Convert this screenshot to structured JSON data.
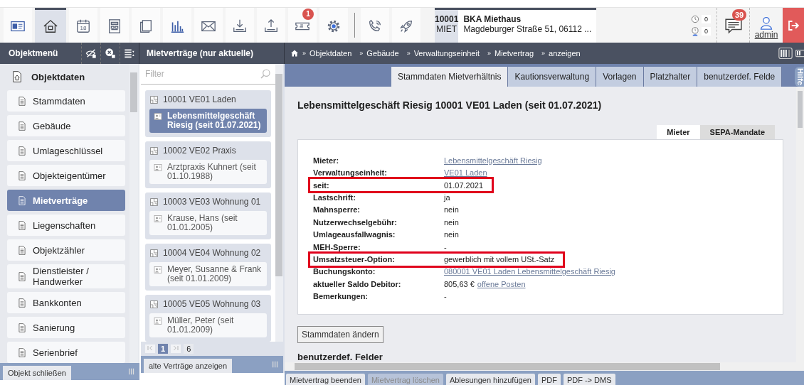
{
  "toolbar": {
    "icons": [
      {
        "kind": "contact-card",
        "selected": false
      },
      {
        "kind": "home",
        "selected": true
      },
      {
        "kind": "calendar",
        "selected": false,
        "label": "18"
      },
      {
        "kind": "form",
        "selected": false
      },
      {
        "kind": "documents",
        "selected": false
      },
      {
        "kind": "chart",
        "selected": false
      },
      {
        "kind": "mail",
        "selected": false
      },
      {
        "kind": "download",
        "selected": false
      },
      {
        "kind": "upload",
        "selected": false
      },
      {
        "kind": "ticket",
        "selected": false,
        "badge": "1"
      },
      {
        "kind": "gear",
        "selected": false
      },
      {
        "kind": "separator"
      },
      {
        "kind": "phone",
        "selected": false
      },
      {
        "kind": "rocket",
        "selected": false
      }
    ]
  },
  "object": {
    "number": "10001",
    "code": "MIET",
    "name": "BKA Miethaus",
    "address": "Magdeburger Straße 51, 06112 ..."
  },
  "counters": [
    {
      "kind": "clock",
      "value": "0"
    },
    {
      "kind": "person-clock",
      "value": "0"
    }
  ],
  "messages": {
    "badge": "39"
  },
  "user": {
    "name": "admin"
  },
  "object_menu": {
    "title": "Objektmenü",
    "header": "Objektdaten",
    "items": [
      {
        "label": "Stammdaten",
        "selected": false
      },
      {
        "label": "Gebäude",
        "selected": false
      },
      {
        "label": "Umlageschlüssel",
        "selected": false
      },
      {
        "label": "Objekteigentümer",
        "selected": false
      },
      {
        "label": "Mietverträge",
        "selected": true
      },
      {
        "label": "Liegenschaften",
        "selected": false
      },
      {
        "label": "Objektzähler",
        "selected": false
      },
      {
        "label": "Dienstleister / Handwerker",
        "selected": false
      },
      {
        "label": "Bankkonten",
        "selected": false
      },
      {
        "label": "Sanierung",
        "selected": false
      },
      {
        "label": "Serienbrief",
        "selected": false
      }
    ],
    "footer_button": "Objekt schließen"
  },
  "contracts": {
    "title": "Mietverträge (nur aktuelle)",
    "filter": {
      "placeholder": "Filter"
    },
    "units": [
      {
        "title": "10001 VE01 Laden",
        "contracts": [
          {
            "label": "Lebensmittelgeschäft Riesig (seit 01.07.2021)",
            "selected": true
          }
        ]
      },
      {
        "title": "10002 VE02 Praxis",
        "contracts": [
          {
            "label": "Arztpraxis Kuhnert (seit 01.10.1988)",
            "selected": false
          }
        ]
      },
      {
        "title": "10003 VE03 Wohnung 01",
        "contracts": [
          {
            "label": "Krause, Hans (seit 01.01.2005)",
            "selected": false
          }
        ]
      },
      {
        "title": "10004 VE04 Wohnung 02",
        "contracts": [
          {
            "label": "Meyer, Susanne & Frank (seit 01.01.2009)",
            "selected": false
          }
        ]
      },
      {
        "title": "10005 VE05 Wohnung 03",
        "contracts": [
          {
            "label": "Müller, Peter (seit 01.01.2009)",
            "selected": false
          }
        ]
      }
    ],
    "pager": {
      "current": "1",
      "total": "6"
    },
    "footer_button": "alte Verträge anzeigen"
  },
  "breadcrumb": {
    "separator": "»",
    "items": [
      "Objektdaten",
      "Gebäude",
      "Verwaltungseinheit",
      "Mietvertrag",
      "anzeigen"
    ]
  },
  "tabs": [
    {
      "label": "Stammdaten Mietverhältnis",
      "selected": true
    },
    {
      "label": "Kautionsverwaltung",
      "selected": false
    },
    {
      "label": "Vorlagen",
      "selected": false
    },
    {
      "label": "Platzhalter",
      "selected": false
    },
    {
      "label": "benutzerdef. Felde",
      "selected": false
    }
  ],
  "help_tab": "Hilfe",
  "heading": "Lebensmittelgeschäft Riesig 10001 VE01 Laden (seit 01.07.2021)",
  "inner_tabs": [
    {
      "label": "Mieter",
      "selected": true
    },
    {
      "label": "SEPA-Mandate",
      "selected": false
    }
  ],
  "fields": [
    {
      "label": "Mieter:",
      "kind": "link",
      "value": "Lebensmittelgeschäft Riesig",
      "highlighted": false
    },
    {
      "label": "Verwaltungseinheit:",
      "kind": "link",
      "value": "VE01 Laden",
      "highlighted": false
    },
    {
      "label": "seit:",
      "kind": "text",
      "value": "01.07.2021",
      "highlighted": true
    },
    {
      "label": "Lastschrift:",
      "kind": "text",
      "value": "ja",
      "highlighted": false
    },
    {
      "label": "Mahnsperre:",
      "kind": "text",
      "value": "nein",
      "highlighted": false
    },
    {
      "label": "Nutzerwechselgebühr:",
      "kind": "text",
      "value": "nein",
      "highlighted": false
    },
    {
      "label": "Umlageausfallwagnis:",
      "kind": "text",
      "value": "nein",
      "highlighted": false
    },
    {
      "label": "MEH-Sperre:",
      "kind": "text",
      "value": "-",
      "highlighted": false
    },
    {
      "label": "Umsatzsteuer-Option:",
      "kind": "text",
      "value": "gewerblich mit vollem USt.-Satz",
      "highlighted": true
    },
    {
      "label": "Buchungskonto:",
      "kind": "link",
      "value": "080001 VE01 Laden Lebensmittelgeschäft Riesig",
      "highlighted": false
    },
    {
      "label": "aktueller Saldo Debitor:",
      "kind": "amount",
      "value": "805,63 €",
      "link": "offene Posten",
      "highlighted": false
    },
    {
      "label": "Bemerkungen:",
      "kind": "text",
      "value": "-",
      "highlighted": false
    }
  ],
  "edit_button": "Stammdaten ändern",
  "section_title": "benutzerdef. Felder",
  "actions": [
    {
      "label": "Mietvertrag beenden",
      "disabled": false
    },
    {
      "label": "Mietvertrag löschen",
      "disabled": true
    },
    {
      "label": "Ablesungen hinzufügen",
      "disabled": false
    },
    {
      "label": "PDF",
      "disabled": false
    },
    {
      "label": "PDF -> DMS",
      "disabled": false
    }
  ]
}
